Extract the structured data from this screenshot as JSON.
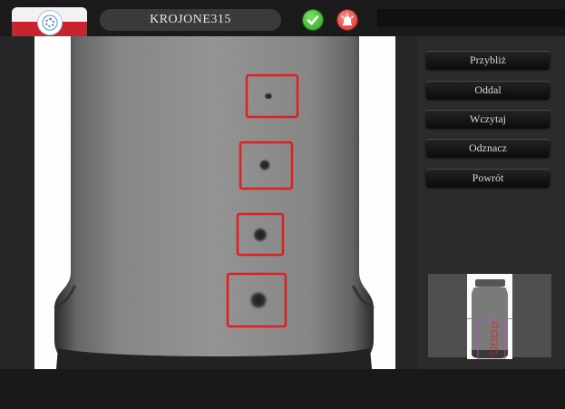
{
  "header": {
    "title": "KROJONE315"
  },
  "icons": {
    "flag": "polish-flag-logo",
    "status_ok": "green-check-icon",
    "alarm": "red-alarm-lamp-icon"
  },
  "colors": {
    "marker": "#e02020",
    "ok": "#33b124",
    "alarm": "#d93030"
  },
  "buttons": {
    "zoom_in": "Przybliż",
    "zoom_out": "Oddal",
    "load": "Wczytaj",
    "unmark": "Odznacz",
    "back": "Powrót"
  },
  "defects": {
    "count": 4
  }
}
